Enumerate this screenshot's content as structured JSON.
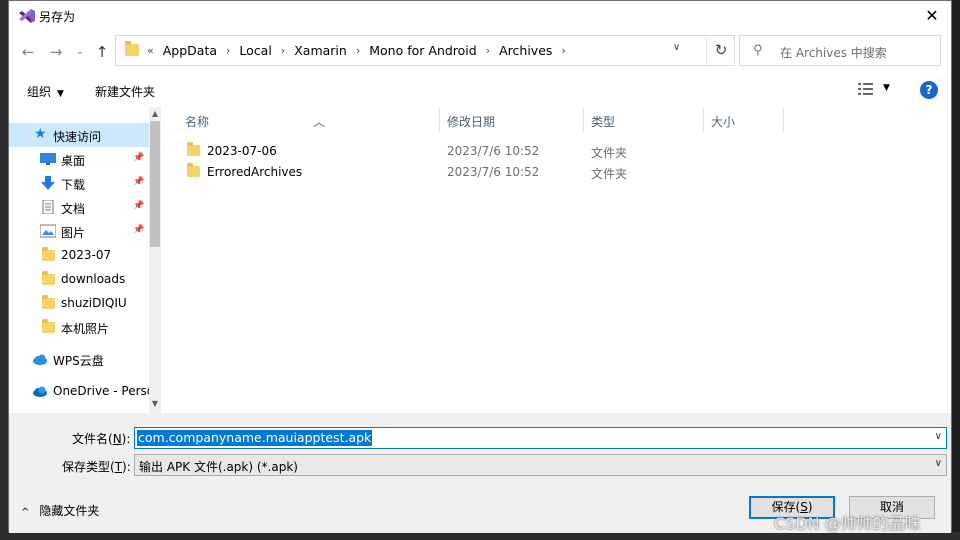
{
  "window": {
    "title": "另存为"
  },
  "address_bar": {
    "overflow": "«",
    "breadcrumbs": [
      "AppData",
      "Local",
      "Xamarin",
      "Mono for Android",
      "Archives"
    ]
  },
  "search": {
    "placeholder": "在 Archives 中搜索"
  },
  "toolbar": {
    "organize_label": "组织",
    "new_folder_label": "新建文件夹"
  },
  "nav_pane": {
    "items": [
      {
        "label": "快速访问",
        "icon": "star-icon",
        "selected": true
      },
      {
        "label": "桌面",
        "icon": "desktop-icon",
        "pinned": true
      },
      {
        "label": "下载",
        "icon": "download-icon",
        "pinned": true
      },
      {
        "label": "文档",
        "icon": "document-icon",
        "pinned": true
      },
      {
        "label": "图片",
        "icon": "picture-icon",
        "pinned": true
      },
      {
        "label": "2023-07",
        "icon": "folder-icon"
      },
      {
        "label": "downloads",
        "icon": "folder-icon"
      },
      {
        "label": "shuziDIQIU",
        "icon": "folder-icon"
      },
      {
        "label": "本机照片",
        "icon": "folder-icon"
      },
      {
        "label": "WPS云盘",
        "icon": "cloud-icon"
      },
      {
        "label": "OneDrive - Perso",
        "icon": "onedrive-icon"
      }
    ]
  },
  "file_list": {
    "columns": [
      "名称",
      "修改日期",
      "类型",
      "大小"
    ],
    "rows": [
      {
        "name": "2023-07-06",
        "date": "2023/7/6 10:52",
        "type": "文件夹"
      },
      {
        "name": "ErroredArchives",
        "date": "2023/7/6 10:52",
        "type": "文件夹"
      }
    ]
  },
  "form": {
    "filename_label": "文件名(",
    "filename_key": "N",
    "filename_label_end": "):",
    "filename_value": "com.companyname.mauiapptest.apk",
    "filetype_label": "保存类型(",
    "filetype_key": "T",
    "filetype_label_end": "):",
    "filetype_value": "输出 APK 文件(.apk) (*.apk)"
  },
  "footer": {
    "hide_folders_label": "隐藏文件夹",
    "save_label": "保存(",
    "save_key": "S",
    "save_label_end": ")",
    "cancel_label": "取消"
  },
  "watermark": "CSDN @帅帅的品味",
  "colors": {
    "selection": "#0078d7",
    "nav_selected": "#cce8ff",
    "folder": "#f5d36a"
  }
}
